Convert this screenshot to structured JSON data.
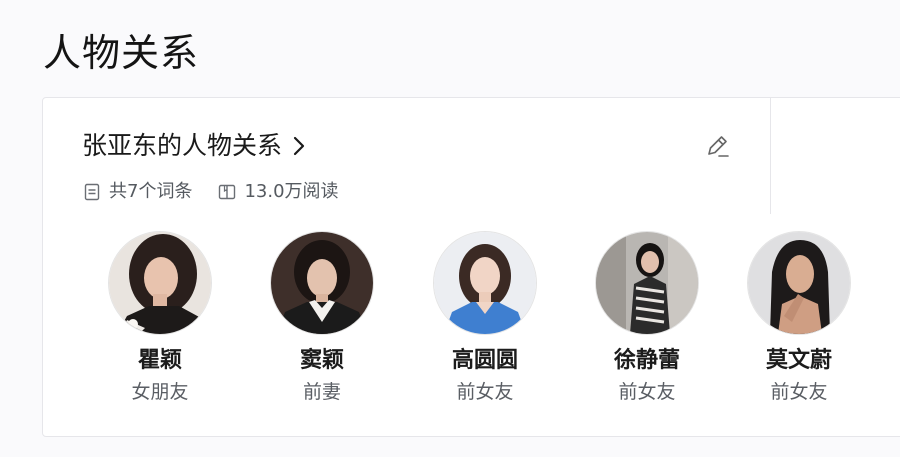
{
  "page": {
    "title": "人物关系"
  },
  "card": {
    "title": "张亚东的人物关系",
    "entry_count": "共7个词条",
    "read_count": "13.0万阅读"
  },
  "people": [
    {
      "name": "瞿颖",
      "relation": "女朋友"
    },
    {
      "name": "窦颖",
      "relation": "前妻"
    },
    {
      "name": "高圆圆",
      "relation": "前女友"
    },
    {
      "name": "徐静蕾",
      "relation": "前女友"
    },
    {
      "name": "莫文蔚",
      "relation": "前女友"
    }
  ],
  "icons": {
    "title_arrow": "chevron-right-icon",
    "edit": "pencil-icon",
    "entries": "document-icon",
    "reads": "book-icon"
  },
  "colors": {
    "page_bg": "#fafafc",
    "card_bg": "#ffffff",
    "border": "#e6e6ea",
    "muted_text": "#555a60"
  }
}
